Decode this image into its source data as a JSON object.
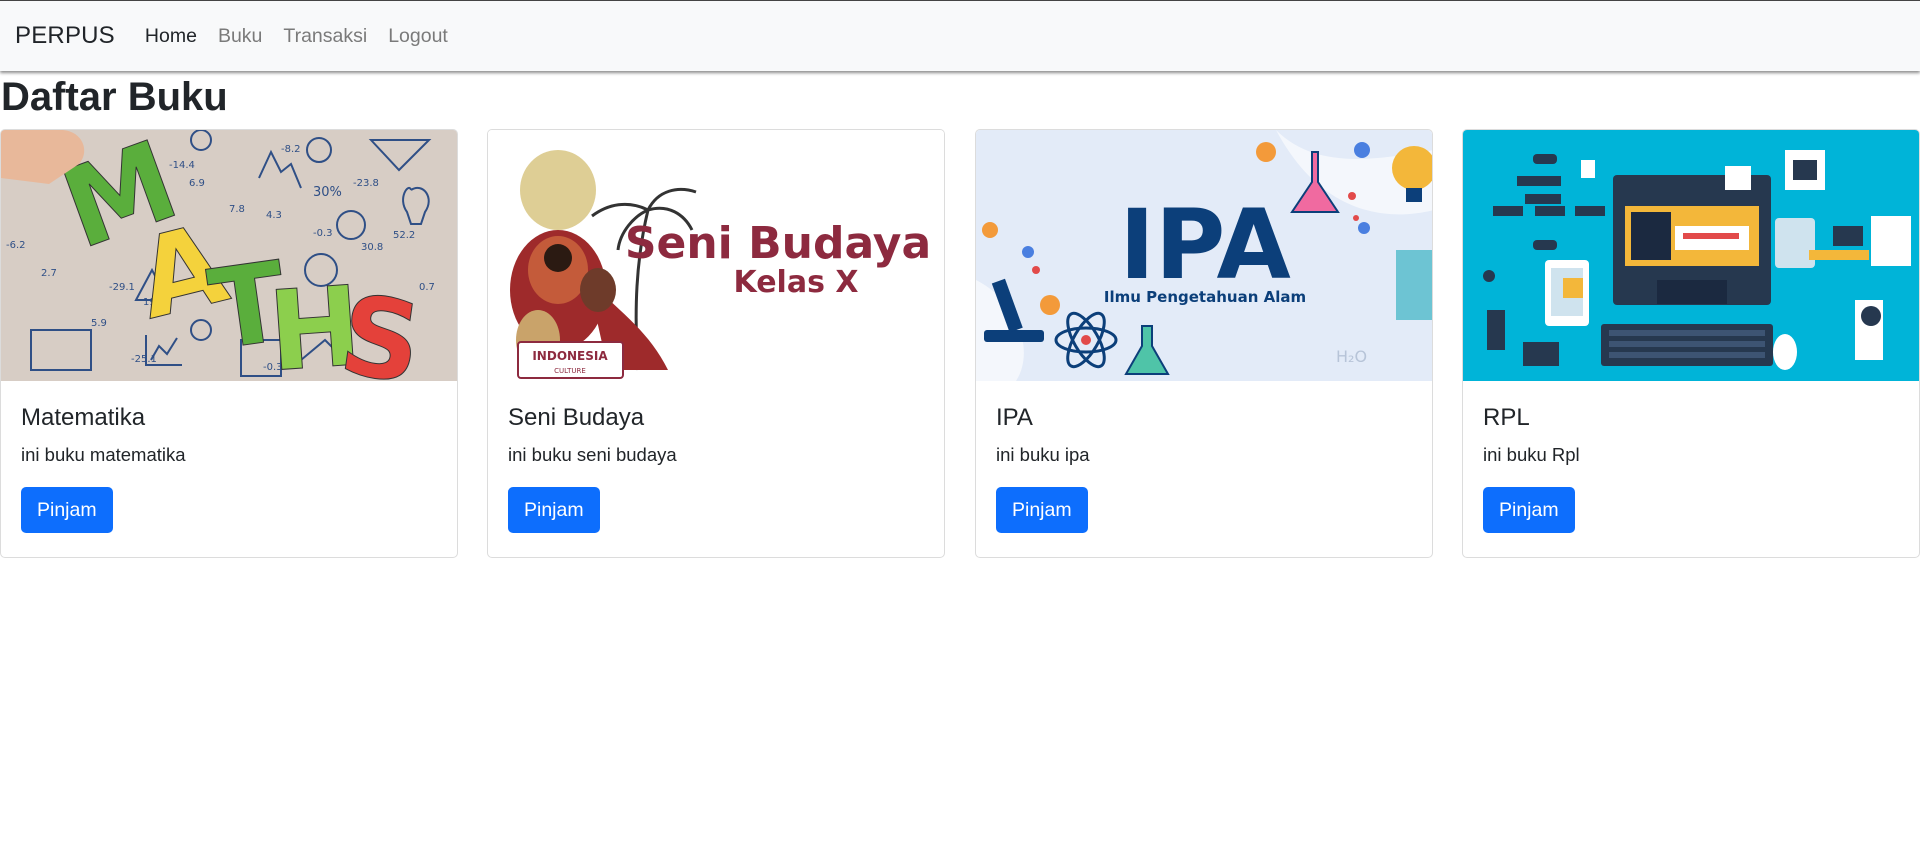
{
  "navbar": {
    "brand": "PERPUS",
    "links": [
      {
        "label": "Home",
        "active": true
      },
      {
        "label": "Buku",
        "active": false
      },
      {
        "label": "Transaksi",
        "active": false
      },
      {
        "label": "Logout",
        "active": false
      }
    ]
  },
  "page": {
    "title": "Daftar Buku"
  },
  "books": [
    {
      "title": "Matematika",
      "description": "ini buku matematika",
      "button": "Pinjam",
      "cover": {
        "text": "MATHS"
      }
    },
    {
      "title": "Seni Budaya",
      "description": "ini buku seni budaya",
      "button": "Pinjam",
      "cover": {
        "line1": "Seni Budaya",
        "line2": "Kelas X",
        "badge_line1": "INDONESIA",
        "badge_line2": "CULTURE"
      }
    },
    {
      "title": "IPA",
      "description": "ini buku ipa",
      "button": "Pinjam",
      "cover": {
        "big": "IPA",
        "sub": "Ilmu Pengetahuan Alam"
      }
    },
    {
      "title": "RPL",
      "description": "ini buku Rpl",
      "button": "Pinjam",
      "cover": {}
    }
  ],
  "colors": {
    "primary": "#0d6efd",
    "navbar_bg": "#f8f9fa",
    "rpl_bg": "#00b4d8",
    "ipa_bg": "#e3ebf8",
    "ipa_text": "#0c3f7a",
    "seni_text": "#8d2a3f"
  }
}
